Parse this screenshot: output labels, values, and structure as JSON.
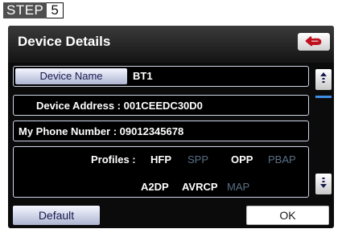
{
  "step": {
    "word": "STEP",
    "number": "5"
  },
  "screen": {
    "title": "Device Details",
    "back_icon": "back-arrow-icon",
    "device_name": {
      "label": "Device Name",
      "value": "BT1"
    },
    "device_address": "Device Address : 001CEEDC30D0",
    "phone_number": "My Phone Number : 09012345678",
    "profiles": {
      "label": "Profiles :",
      "items": [
        {
          "name": "HFP",
          "active": true
        },
        {
          "name": "SPP",
          "active": false
        },
        {
          "name": "OPP",
          "active": true
        },
        {
          "name": "PBAP",
          "active": false
        },
        {
          "name": "A2DP",
          "active": true
        },
        {
          "name": "AVRCP",
          "active": true
        },
        {
          "name": "MAP",
          "active": false
        }
      ]
    },
    "scroll_up_icon": "scroll-up-icon",
    "scroll_down_icon": "scroll-down-icon",
    "default_label": "Default",
    "ok_label": "OK"
  },
  "colors": {
    "active_profile": "#ffffff",
    "inactive_profile": "#5b6f86",
    "scroll_indicator": "#3e8ee8"
  }
}
